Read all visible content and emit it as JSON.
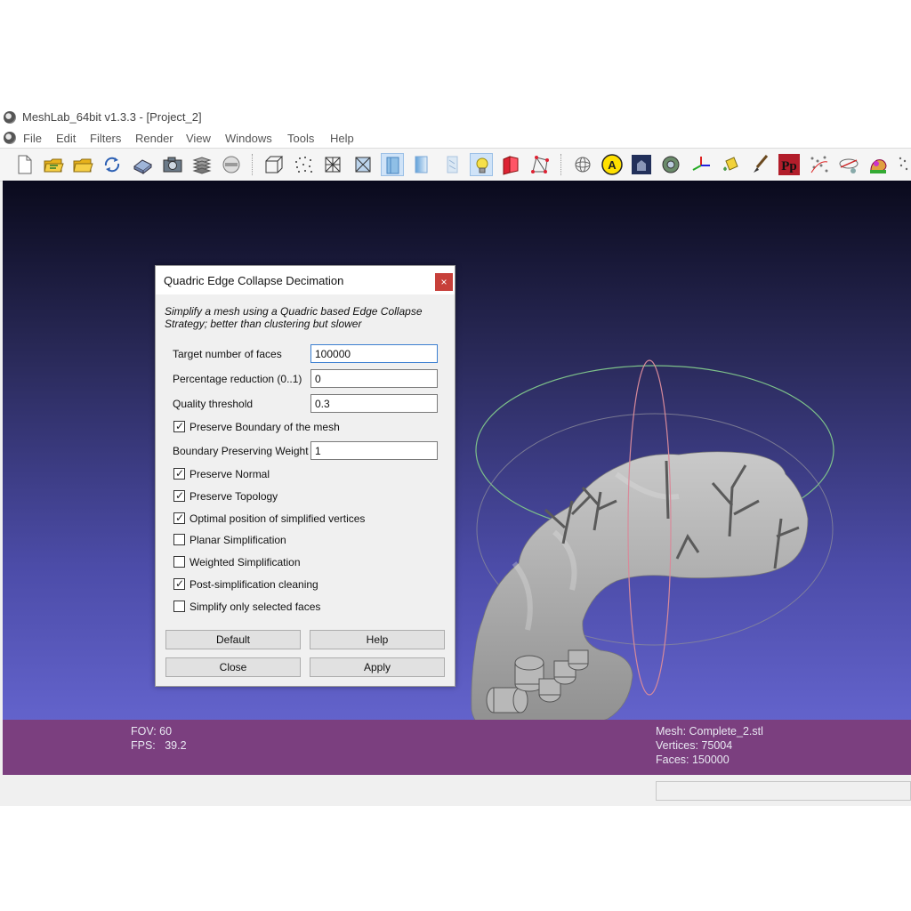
{
  "window": {
    "title": "MeshLab_64bit v1.3.3 - [Project_2]"
  },
  "menu": [
    "File",
    "Edit",
    "Filters",
    "Render",
    "View",
    "Windows",
    "Tools",
    "Help"
  ],
  "toolbar": {
    "icons": [
      "new-file-icon",
      "open-project-icon",
      "open-folder-icon",
      "reload-icon",
      "save-icon",
      "snapshot-icon",
      "layers-icon",
      "import-raster-icon",
      "bbox-icon",
      "points-icon",
      "wireframe-icon",
      "hidden-lines-icon",
      "flat-shading-icon",
      "smooth-shading-icon",
      "texture-icon",
      "lighting-icon",
      "backface-icon",
      "selected-faces-icon",
      "trackball-icon",
      "annotation-icon",
      "raster-icon",
      "measure-icon",
      "axes-icon",
      "paint-bucket-icon",
      "brush-icon",
      "pick-points-icon",
      "align-icon",
      "camera-icon",
      "color-picker-icon",
      "reference-icon"
    ],
    "active": [
      "flat-shading-icon",
      "lighting-icon"
    ]
  },
  "dialog": {
    "title": "Quadric Edge Collapse Decimation",
    "close_label": "×",
    "description": "Simplify a mesh using a Quadric based Edge Collapse Strategy; better than clustering but slower",
    "fields": [
      {
        "label": "Target number of faces",
        "value": "100000"
      },
      {
        "label": "Percentage reduction (0..1)",
        "value": "0"
      },
      {
        "label": "Quality threshold",
        "value": "0.3"
      }
    ],
    "preserve_boundary": {
      "label": "Preserve Boundary of the mesh",
      "checked": true
    },
    "boundary_weight": {
      "label": "Boundary Preserving Weight",
      "value": "1"
    },
    "checkboxes": [
      {
        "label": "Preserve Normal",
        "checked": true
      },
      {
        "label": "Preserve Topology",
        "checked": true
      },
      {
        "label": "Optimal position of simplified vertices",
        "checked": true
      },
      {
        "label": "Planar Simplification",
        "checked": false
      },
      {
        "label": "Weighted Simplification",
        "checked": false
      },
      {
        "label": "Post-simplification cleaning",
        "checked": true
      },
      {
        "label": "Simplify only selected faces",
        "checked": false
      }
    ],
    "buttons": {
      "default": "Default",
      "help": "Help",
      "close": "Close",
      "apply": "Apply"
    }
  },
  "info": {
    "fov": "FOV: 60",
    "fps": "FPS:   39.2",
    "mesh": "Mesh: Complete_2.stl",
    "vertices": "Vertices: 75004",
    "faces": "Faces: 150000"
  },
  "colors": {
    "info_bar": "#7b3f7f",
    "viewport_top": "#0a0a1c",
    "viewport_bottom": "#6b6bd8",
    "close_button": "#c7403a"
  }
}
